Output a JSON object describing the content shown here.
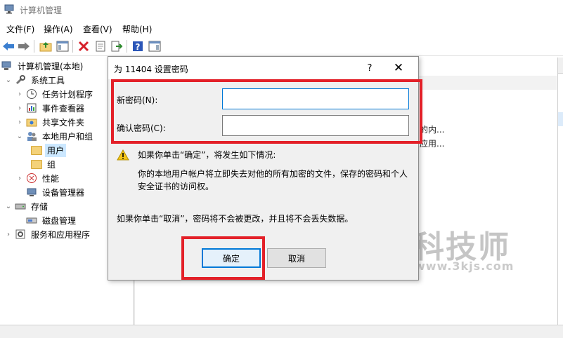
{
  "window": {
    "title": "计算机管理"
  },
  "menubar": {
    "items": [
      "文件(F)",
      "操作(A)",
      "查看(V)",
      "帮助(H)"
    ]
  },
  "toolbar": {
    "icons": [
      "back-arrow-icon",
      "forward-arrow-icon",
      "up-folder-icon",
      "show-hide-tree-icon",
      "delete-icon",
      "properties-icon",
      "export-list-icon",
      "help-icon",
      "show-action-pane-icon"
    ]
  },
  "tree": {
    "items": [
      {
        "label": "计算机管理(本地)",
        "expanded": true,
        "icon": "computer-management-icon"
      },
      {
        "label": "系统工具",
        "expanded": true,
        "icon": "tools-icon"
      },
      {
        "label": "任务计划程序",
        "expanded": false,
        "icon": "clock-icon"
      },
      {
        "label": "事件查看器",
        "expanded": false,
        "icon": "event-viewer-icon"
      },
      {
        "label": "共享文件夹",
        "expanded": false,
        "icon": "shared-folder-icon"
      },
      {
        "label": "本地用户和组",
        "expanded": true,
        "icon": "users-icon"
      },
      {
        "label": "用户",
        "selected": true,
        "icon": "folder-icon"
      },
      {
        "label": "组",
        "icon": "folder-icon"
      },
      {
        "label": "性能",
        "expanded": false,
        "icon": "performance-icon"
      },
      {
        "label": "设备管理器",
        "icon": "device-manager-icon"
      },
      {
        "label": "存储",
        "expanded": true,
        "icon": "storage-icon"
      },
      {
        "label": "磁盘管理",
        "icon": "disk-management-icon"
      },
      {
        "label": "服务和应用程序",
        "expanded": false,
        "icon": "services-icon"
      }
    ]
  },
  "center": {
    "fragments": [
      "的内...",
      "应用..."
    ]
  },
  "dialog": {
    "title": "为 11404 设置密码",
    "help_label": "?",
    "close_label": "✕",
    "new_password_label": "新密码(N):",
    "new_password_value": "",
    "confirm_password_label": "确认密码(C):",
    "confirm_password_value": "",
    "warning_line": "如果你单击“确定”，将发生如下情况:",
    "warning_detail_line1": "你的本地用户帐户将立即失去对他的所有加密的文件，保存的密码和个人",
    "warning_detail_line2": "安全证书的访问权。",
    "cancel_note": "如果你单击“取消”，密码将不会被更改，并且将不会丢失数据。",
    "ok_label": "确定",
    "cancel_label": "取消"
  },
  "watermark": {
    "brand": "科技师",
    "url": "www.3kjs.com"
  },
  "colors": {
    "highlight_red": "#e32028",
    "focus_blue": "#0078d7",
    "selection": "#cce8ff"
  }
}
